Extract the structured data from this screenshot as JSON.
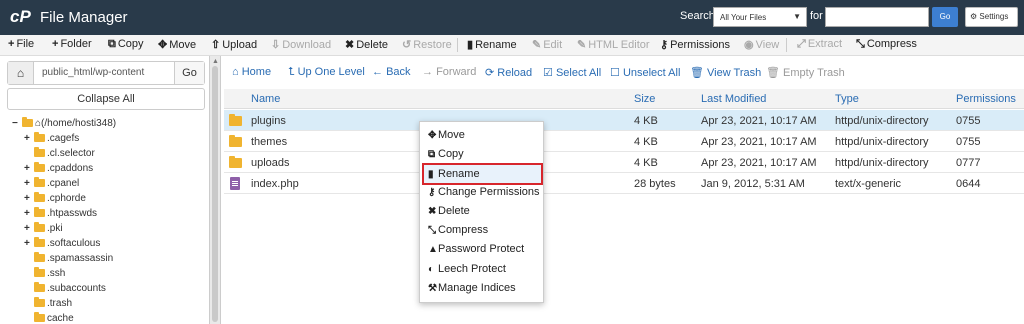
{
  "app": {
    "title": "File Manager",
    "logo_text": "cP"
  },
  "search": {
    "label": "Search",
    "scope": "All Your Files",
    "for_label": "for",
    "placeholder": "",
    "go_label": "Go",
    "settings_label": "Settings"
  },
  "toolbar": {
    "file": "File",
    "folder": "Folder",
    "copy": "Copy",
    "move": "Move",
    "upload": "Upload",
    "download": "Download",
    "delete": "Delete",
    "restore": "Restore",
    "rename": "Rename",
    "edit": "Edit",
    "html_editor": "HTML Editor",
    "permissions": "Permissions",
    "view": "View",
    "extract": "Extract",
    "compress": "Compress"
  },
  "left": {
    "path": "public_html/wp-content",
    "go_label": "Go",
    "collapse_label": "Collapse All",
    "tree_root": "(/home/hosti348)",
    "tree": [
      ".cagefs",
      ".cl.selector",
      ".cpaddons",
      ".cpanel",
      ".cphorde",
      ".htpasswds",
      ".pki",
      ".softaculous",
      ".spamassassin",
      ".ssh",
      ".subaccounts",
      ".trash",
      "cache"
    ]
  },
  "nav": {
    "home": "Home",
    "up": "Up One Level",
    "back": "Back",
    "forward": "Forward",
    "reload": "Reload",
    "select_all": "Select All",
    "unselect_all": "Unselect All",
    "view_trash": "View Trash",
    "empty_trash": "Empty Trash"
  },
  "table": {
    "headers": {
      "name": "Name",
      "size": "Size",
      "modified": "Last Modified",
      "type": "Type",
      "perms": "Permissions"
    },
    "rows": [
      {
        "name": "plugins",
        "size": "4 KB",
        "modified": "Apr 23, 2021, 10:17 AM",
        "type": "httpd/unix-directory",
        "perms": "0755"
      },
      {
        "name": "themes",
        "size": "4 KB",
        "modified": "Apr 23, 2021, 10:17 AM",
        "type": "httpd/unix-directory",
        "perms": "0755"
      },
      {
        "name": "uploads",
        "size": "4 KB",
        "modified": "Apr 23, 2021, 10:17 AM",
        "type": "httpd/unix-directory",
        "perms": "0777"
      },
      {
        "name": "index.php",
        "size": "28 bytes",
        "modified": "Jan 9, 2012, 5:31 AM",
        "type": "text/x-generic",
        "perms": "0644"
      }
    ]
  },
  "context_menu": {
    "items": [
      "Move",
      "Copy",
      "Rename",
      "Change Permissions",
      "Delete",
      "Compress",
      "Password Protect",
      "Leech Protect",
      "Manage Indices"
    ]
  }
}
